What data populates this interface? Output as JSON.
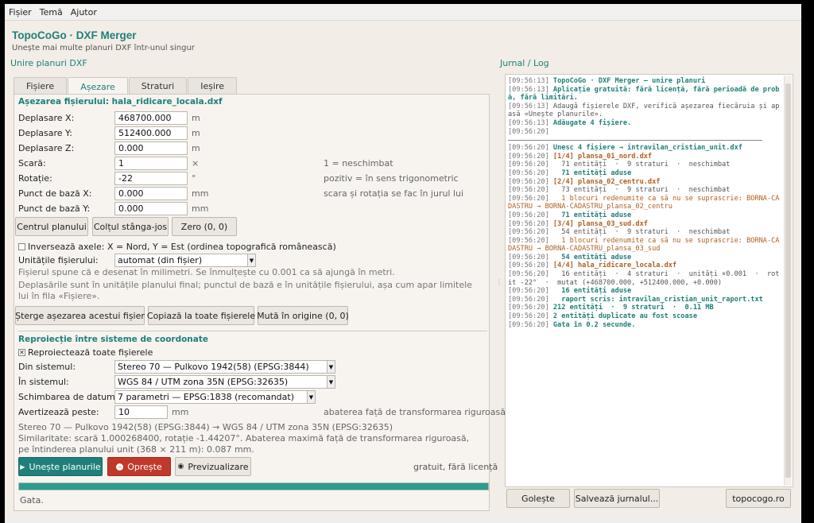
{
  "menu": [
    "Fișier",
    "Temă",
    "Ajutor"
  ],
  "app": {
    "title": "TopoCoGo · DXF Merger",
    "subtitle": "Unește mai multe planuri DXF într-unul singur"
  },
  "left_section_title": "Unire planuri DXF",
  "log_section_title": "Jurnal / Log",
  "tabs": [
    "Fișiere",
    "Așezare",
    "Straturi",
    "Ieșire"
  ],
  "placement": {
    "heading": "Așezarea fișierului: hala_ridicare_locala.dxf",
    "fields": [
      {
        "label": "Deplasare X:",
        "value": "468700.000",
        "unit": "m",
        "hint": ""
      },
      {
        "label": "Deplasare Y:",
        "value": "512400.000",
        "unit": "m",
        "hint": ""
      },
      {
        "label": "Deplasare Z:",
        "value": "0.000",
        "unit": "m",
        "hint": ""
      },
      {
        "label": "Scară:",
        "value": "1",
        "unit": "×",
        "hint": "1 = neschimbat"
      },
      {
        "label": "Rotație:",
        "value": "-22",
        "unit": "°",
        "hint": "pozitiv = în sens trigonometric"
      },
      {
        "label": "Punct de bază X:",
        "value": "0.000",
        "unit": "mm",
        "hint": "scara și rotația se fac în jurul lui"
      },
      {
        "label": "Punct de bază Y:",
        "value": "0.000",
        "unit": "mm",
        "hint": ""
      }
    ],
    "buttons": [
      "Centrul planului",
      "Colțul stânga-jos",
      "Zero (0, 0)"
    ],
    "invert_axes_label": "Inversează axele: X = Nord, Y = Est (ordinea topografică românească)",
    "units_label": "Unitățile fișierului:",
    "units_value": "automat (din fișier)",
    "units_note": "Fișierul spune că e desenat în milimetri. Se înmulțește cu 0.001 ca să ajungă în metri.",
    "offsets_note": "Deplasările sunt în unitățile planului final; punctul de bază e în unitățile fișierului, așa cum apar limitele lui în fila «Fișiere».",
    "action_buttons": [
      "Șterge așezarea acestui fișier",
      "Copiază la toate fișierele",
      "Mută în origine (0, 0)"
    ]
  },
  "reproj": {
    "heading": "Reproiecție între sisteme de coordonate",
    "checkbox_label": "Reproiectează toate fișierele",
    "checkbox_mark": "✕",
    "from_label": "Din sistemul:",
    "from_value": "Stereo 70 — Pulkovo 1942(58) (EPSG:3844)",
    "to_label": "În sistemul:",
    "to_value": "WGS 84 / UTM zona 35N (EPSG:32635)",
    "datum_label": "Schimbarea de datum:",
    "datum_value": "7 parametri — EPSG:1838 (recomandat)",
    "warn_label": "Avertizează peste:",
    "warn_value": "10",
    "warn_unit": "mm",
    "warn_hint": "abaterea față de transformarea riguroasă",
    "summary_1": "Stereo 70 — Pulkovo 1942(58) (EPSG:3844) → WGS 84 / UTM zona 35N (EPSG:32635)",
    "summary_2": "Similaritate: scară 1.000268400, rotație -1.44207°.  Abaterea maximă față de transformarea riguroasă, pe întinderea planului unit (368 × 211 m): 0.087 mm."
  },
  "run": {
    "merge": "Unește planurile",
    "merge_icon": "play-icon",
    "stop": "Oprește",
    "stop_icon": "stop-icon",
    "preview": "Previzualizare",
    "preview_icon": "eye-icon",
    "license": "gratuit, fără licență",
    "progress": 1.0,
    "status": "Gata."
  },
  "log": {
    "block1": [
      {
        "t": "[09:56:13] ",
        "msg": "TopoCoGo · DXF Merger — unire planuri",
        "style": "bold"
      },
      {
        "t": "[09:56:13] ",
        "msg": "Aplicație gratuită: fără licență, fără perioadă de probă, fără limitări.",
        "style": "bold"
      },
      {
        "t": "[09:56:13] ",
        "msg": "Adaugă fișierele DXF, verifică așezarea fiecăruia și apasă «Unește planurile».",
        "style": "plain"
      },
      {
        "t": "[09:56:13] ",
        "msg": "Adăugate 4 fișiere.",
        "style": "bold"
      },
      {
        "t": "[09:56:20] ",
        "msg": "",
        "style": "plain"
      }
    ],
    "block2": [
      {
        "t": "[09:56:20] ",
        "msg": "Unesc 4 fișiere → intravilan_cristian_unit.dxf",
        "style": "bold"
      },
      {
        "t": "[09:56:20] ",
        "msg": "[1/4] plansa_01_nord.dxf",
        "style": "orange-bold"
      },
      {
        "t": "[09:56:20] ",
        "msg": "  71 entități  ·  9 straturi  ·  neschimbat",
        "style": "plain"
      },
      {
        "t": "[09:56:20] ",
        "msg": "  71 entități aduse",
        "style": "bold"
      },
      {
        "t": "[09:56:20] ",
        "msg": "[2/4] plansa_02_centru.dxf",
        "style": "orange-bold"
      },
      {
        "t": "[09:56:20] ",
        "msg": "  73 entități  ·  9 straturi  ·  neschimbat",
        "style": "plain"
      },
      {
        "t": "[09:56:20] ",
        "msg": "  1 blocuri redenumite ca să nu se suprascrie: BORNA-CADASTRU → BORNA-CADASTRU_plansa_02_centru",
        "style": "orange"
      },
      {
        "t": "[09:56:20] ",
        "msg": "  71 entități aduse",
        "style": "bold"
      },
      {
        "t": "[09:56:20] ",
        "msg": "[3/4] plansa_03_sud.dxf",
        "style": "orange-bold"
      },
      {
        "t": "[09:56:20] ",
        "msg": "  54 entități  ·  9 straturi  ·  neschimbat",
        "style": "plain"
      },
      {
        "t": "[09:56:20] ",
        "msg": "  1 blocuri redenumite ca să nu se suprascrie: BORNA-CADASTRU → BORNA-CADASTRU_plansa_03_sud",
        "style": "orange"
      },
      {
        "t": "[09:56:20] ",
        "msg": "  54 entități aduse",
        "style": "bold"
      },
      {
        "t": "[09:56:20] ",
        "msg": "[4/4] hala_ridicare_locala.dxf",
        "style": "orange-bold"
      },
      {
        "t": "[09:56:20] ",
        "msg": "  16 entități  ·  4 straturi  ·  unități ×0.001  ·  rotit -22°  ·  mutat (+468700.000, +512400.000, +0.000)",
        "style": "plain"
      },
      {
        "t": "[09:56:20] ",
        "msg": "  16 entități aduse",
        "style": "bold"
      },
      {
        "t": "[09:56:20] ",
        "msg": "  raport scris: intravilan_cristian_unit_raport.txt",
        "style": "bold"
      },
      {
        "t": "[09:56:20] ",
        "msg": "212 entități  ·  9 straturi  ·  0.11 MB",
        "style": "bold"
      },
      {
        "t": "[09:56:20] ",
        "msg": "2 entități duplicate au fost scoase",
        "style": "bold"
      },
      {
        "t": "[09:56:20] ",
        "msg": "Gata în 0.2 secunde.",
        "style": "bold"
      }
    ],
    "buttons": [
      "Golește",
      "Salvează jurnalul...",
      "topocogo.ro"
    ]
  },
  "colors": {
    "accent": "#1e8079",
    "merge_bg": "#1e8079",
    "stop_bg": "#c0392b",
    "log_orange": "#b06020"
  }
}
